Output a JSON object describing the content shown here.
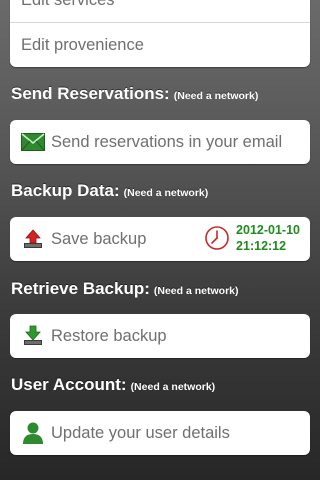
{
  "top_group": {
    "items": [
      {
        "label": "Edit services"
      },
      {
        "label": "Edit provenience"
      }
    ]
  },
  "send_reservations": {
    "title": "Send Reservations:",
    "note": "(Need a network)",
    "button_label": "Send reservations in your email",
    "icon": "envelope-icon"
  },
  "backup": {
    "title": "Backup Data:",
    "note": "(Need a network)",
    "button_label": "Save backup",
    "icon": "upload-tray-icon",
    "last_backup_date": "2012-01-10",
    "last_backup_time": "21:12:12",
    "clock_icon": "clock-icon",
    "timestamp_color": "#1e8c1e"
  },
  "retrieve": {
    "title": "Retrieve Backup:",
    "note": "(Need a network)",
    "button_label": "Restore backup",
    "icon": "download-tray-icon"
  },
  "user_account": {
    "title": "User Account:",
    "note": "(Need a network)",
    "button_label": "Update your user details",
    "icon": "user-icon"
  }
}
